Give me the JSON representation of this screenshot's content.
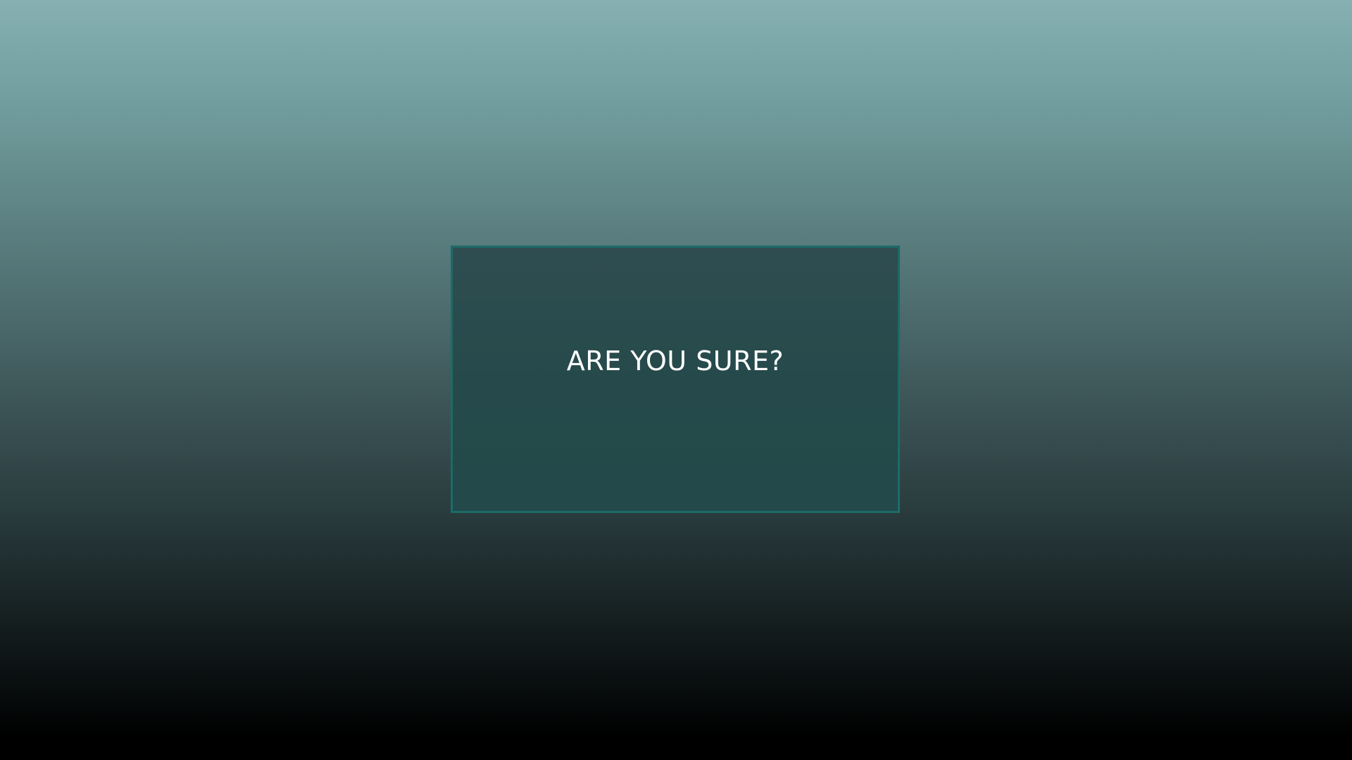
{
  "dialog": {
    "title": "ARE YOU SURE?"
  },
  "colors": {
    "background_top": "#86b0b1",
    "background_bottom": "#000000",
    "dialog_fill": "#264a4b",
    "dialog_border": "#1c6b68",
    "text": "#ffffff"
  }
}
